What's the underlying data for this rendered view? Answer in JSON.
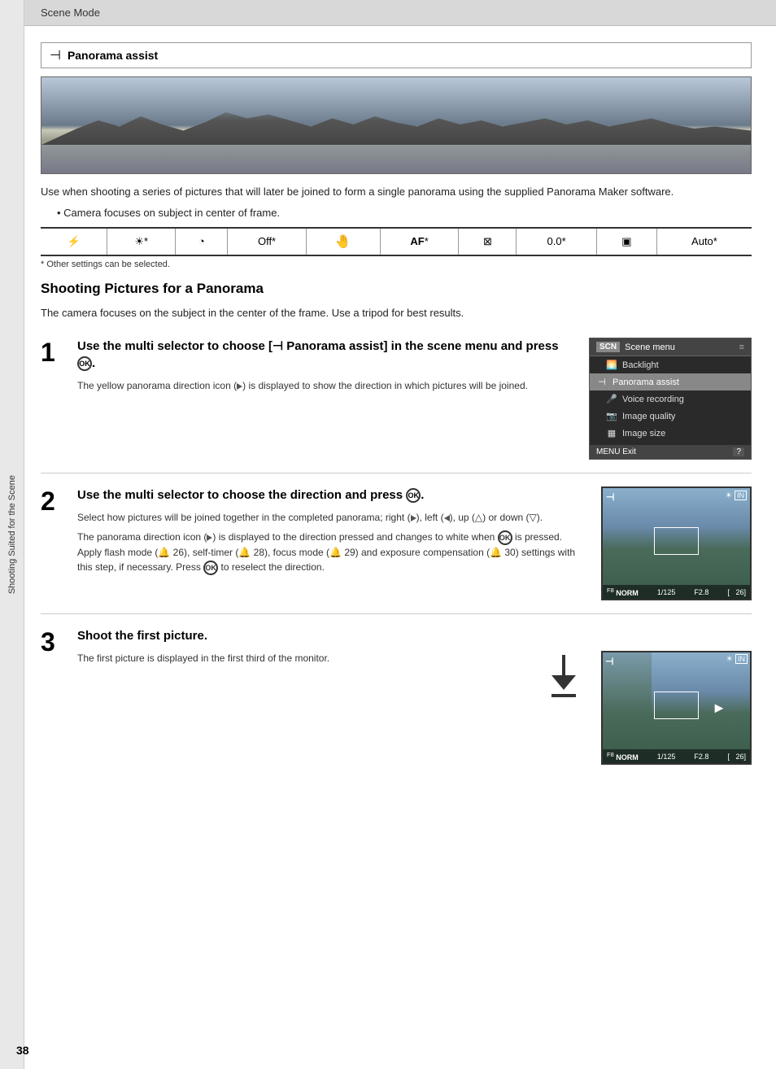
{
  "header": {
    "title": "Scene Mode"
  },
  "sidebar": {
    "text": "Shooting Suited for the Scene"
  },
  "section": {
    "icon": "⊣",
    "title": "Panorama assist",
    "description": "Use when shooting a series of pictures that will later be joined to form a single panorama using the supplied Panorama Maker software.",
    "bullet": "Camera focuses on subject in center of frame.",
    "settings_note": "*  Other settings can be selected.",
    "settings": [
      {
        "value": "⚡",
        "label": "flash"
      },
      {
        "value": "☀*",
        "label": "light"
      },
      {
        "value": "◔",
        "label": "timer"
      },
      {
        "value": "Off*",
        "label": "off"
      },
      {
        "value": "🤚",
        "label": "vr"
      },
      {
        "value": "AF*",
        "label": "af"
      },
      {
        "value": "⊠",
        "label": "exp"
      },
      {
        "value": "0.0*",
        "label": "comp"
      },
      {
        "value": "▣",
        "label": "metering"
      },
      {
        "value": "Auto*",
        "label": "iso"
      }
    ]
  },
  "shooting_section": {
    "heading": "Shooting Pictures for a Panorama",
    "intro": "The camera focuses on the subject in the center of the frame. Use a tripod for best results.",
    "steps": [
      {
        "number": "1",
        "instruction": "Use the multi selector to choose [⊣ Panorama assist] in the scene menu and press Ⓢ.",
        "detail": "The yellow panorama direction icon (▷) is displayed to show the direction in which pictures will be joined.",
        "menu": {
          "header": "SCN  Scene menu",
          "items": [
            {
              "icon": "🌅",
              "label": "Backlight",
              "active": false
            },
            {
              "icon": "⊣",
              "label": "Panorama assist",
              "active": true
            },
            {
              "icon": "🎙",
              "label": "Voice recording",
              "active": false
            },
            {
              "icon": "📷",
              "label": "Image quality",
              "active": false
            },
            {
              "icon": "▦",
              "label": "Image size",
              "active": false
            }
          ],
          "footer_left": "MENU Exit",
          "footer_right": "?"
        }
      },
      {
        "number": "2",
        "instruction": "Use the multi selector to choose the direction and press Ⓢ.",
        "detail1": "Select how pictures will be joined together in the completed panorama; right (▷), left (◁), up (△) or down (▽).",
        "detail2": "The panorama direction icon (▷) is displayed to the direction pressed and changes to white when Ⓢ is pressed. Apply flash mode (🔔 26), self-timer (🔔 28), focus mode (🔔 29) and exposure compensation (🔔 30) settings with this step, if necessary. Press Ⓢ to reselect the direction.",
        "camera_display": {
          "top_left": "⊣",
          "top_right_icons": [
            "☀",
            "IN"
          ],
          "bottom": "F⁸ NORM  1/125    F2.8  [    26]"
        }
      },
      {
        "number": "3",
        "instruction": "Shoot the first picture.",
        "detail": "The first picture is displayed in the first third of the monitor.",
        "camera_display": {
          "top_left": "⊣",
          "top_right_icons": [
            "☀",
            "IN"
          ],
          "bottom": "F⁸ NORM  1/125    F2.8  [    26]"
        }
      }
    ]
  },
  "page_number": "38"
}
